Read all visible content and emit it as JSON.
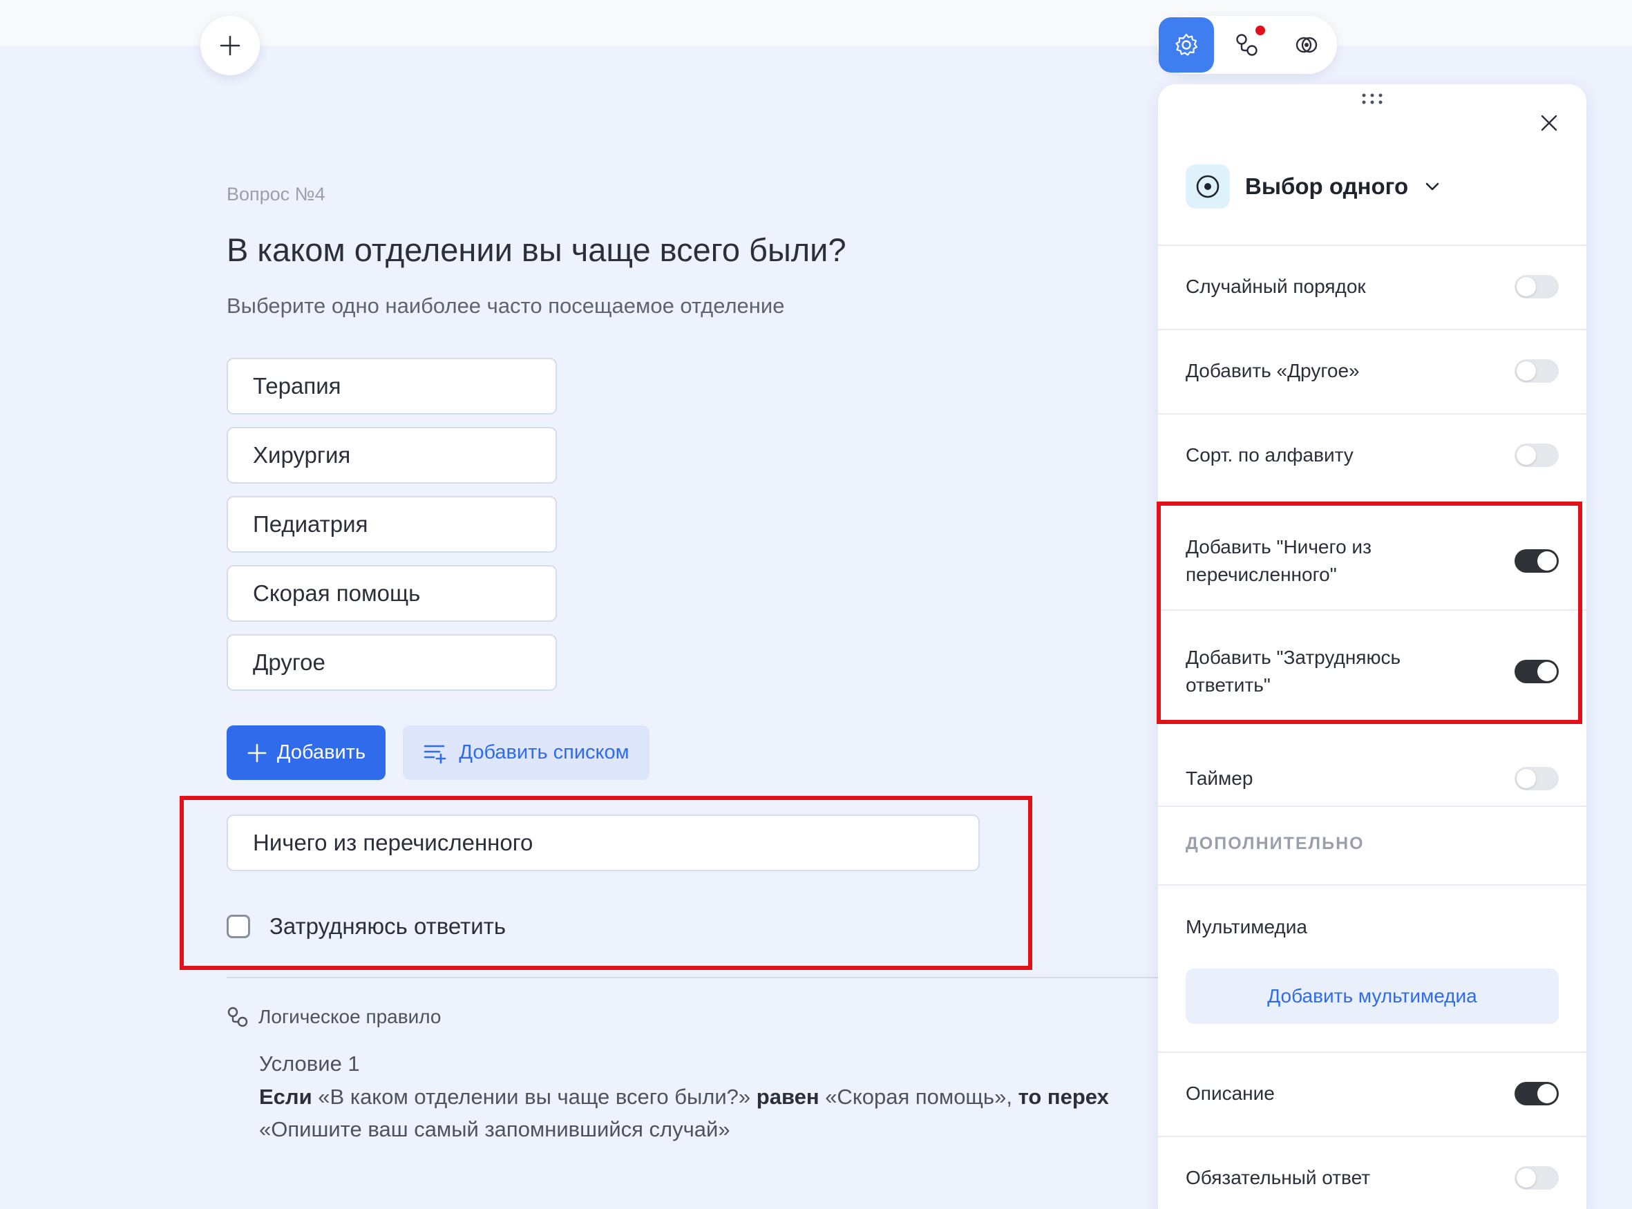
{
  "question": {
    "number_label": "Вопрос №4",
    "title": "В каком отделении вы чаще всего были?",
    "description": "Выберите одно наиболее часто посещаемое отделение",
    "options": [
      "Терапия",
      "Хирургия",
      "Педиатрия",
      "Скорая помощь",
      "Другое"
    ],
    "add_button": "Добавить",
    "add_list_button": "Добавить списком",
    "none_option": "Ничего из перечисленного",
    "hard_to_answer": "Затрудняюсь ответить"
  },
  "logic": {
    "header": "Логическое правило",
    "condition_title": "Условие 1",
    "if_word": "Если",
    "if_subject": "«В каком отделении вы чаще всего были?»",
    "equals_word": "равен",
    "equals_value": "«Скорая помощь»,",
    "then_word": "то перех",
    "target": "«Опишите ваш самый запомнившийся случай»"
  },
  "panel": {
    "tabs": [
      "settings-icon",
      "logic-icon",
      "preview-icon"
    ],
    "question_type": "Выбор одного",
    "settings": [
      {
        "label": "Случайный порядок",
        "on": false
      },
      {
        "label": "Добавить «Другое»",
        "on": false
      },
      {
        "label": "Сорт. по алфавиту",
        "on": false
      },
      {
        "label": "Добавить \"Ничего из перечисленного\"",
        "on": true
      },
      {
        "label": "Добавить \"Затрудняюсь ответить\"",
        "on": true
      },
      {
        "label": "Таймер",
        "on": false
      }
    ],
    "section_extra": "ДОПОЛНИТЕЛЬНО",
    "multimedia_label": "Мультимедиа",
    "multimedia_button": "Добавить мультимедиа",
    "description_label": "Описание",
    "description_on": true,
    "required_label": "Обязательный ответ",
    "required_on": false
  },
  "colors": {
    "accent": "#2f6bea",
    "highlight": "#e3101a",
    "background": "#eef2fd"
  }
}
